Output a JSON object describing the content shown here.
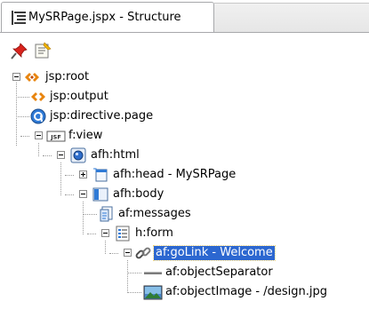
{
  "panel": {
    "tab_title": "MySRPage.jspx - Structure"
  },
  "toolbar": {
    "buttons": [
      {
        "icon": "pin-icon"
      },
      {
        "icon": "show-source-icon"
      }
    ]
  },
  "tree": {
    "nodes": [
      {
        "label": "jsp:root",
        "icon": "jsp-root-icon",
        "toggle": "expanded"
      },
      {
        "label": "jsp:output",
        "icon": "jsp-tag-icon",
        "toggle": "none"
      },
      {
        "label": "jsp:directive.page",
        "icon": "directive-icon",
        "toggle": "none"
      },
      {
        "label": "f:view",
        "icon": "jsf-icon",
        "toggle": "expanded"
      },
      {
        "label": "afh:html",
        "icon": "html-icon",
        "toggle": "expanded"
      },
      {
        "label": "afh:head - MySRPage",
        "icon": "head-icon",
        "toggle": "collapsed"
      },
      {
        "label": "afh:body",
        "icon": "body-icon",
        "toggle": "expanded"
      },
      {
        "label": "af:messages",
        "icon": "messages-icon",
        "toggle": "none"
      },
      {
        "label": "h:form",
        "icon": "form-icon",
        "toggle": "expanded"
      },
      {
        "label": "af:goLink - Welcome",
        "icon": "link-icon",
        "toggle": "expanded",
        "selected": true
      },
      {
        "label": "af:objectSeparator",
        "icon": "separator-icon",
        "toggle": "none"
      },
      {
        "label": "af:objectImage - /design.jpg",
        "icon": "image-icon",
        "toggle": "none"
      }
    ]
  },
  "colors": {
    "selection": "#2c67d0",
    "accent_orange": "#e8850f",
    "accent_blue": "#2f7ad6"
  }
}
